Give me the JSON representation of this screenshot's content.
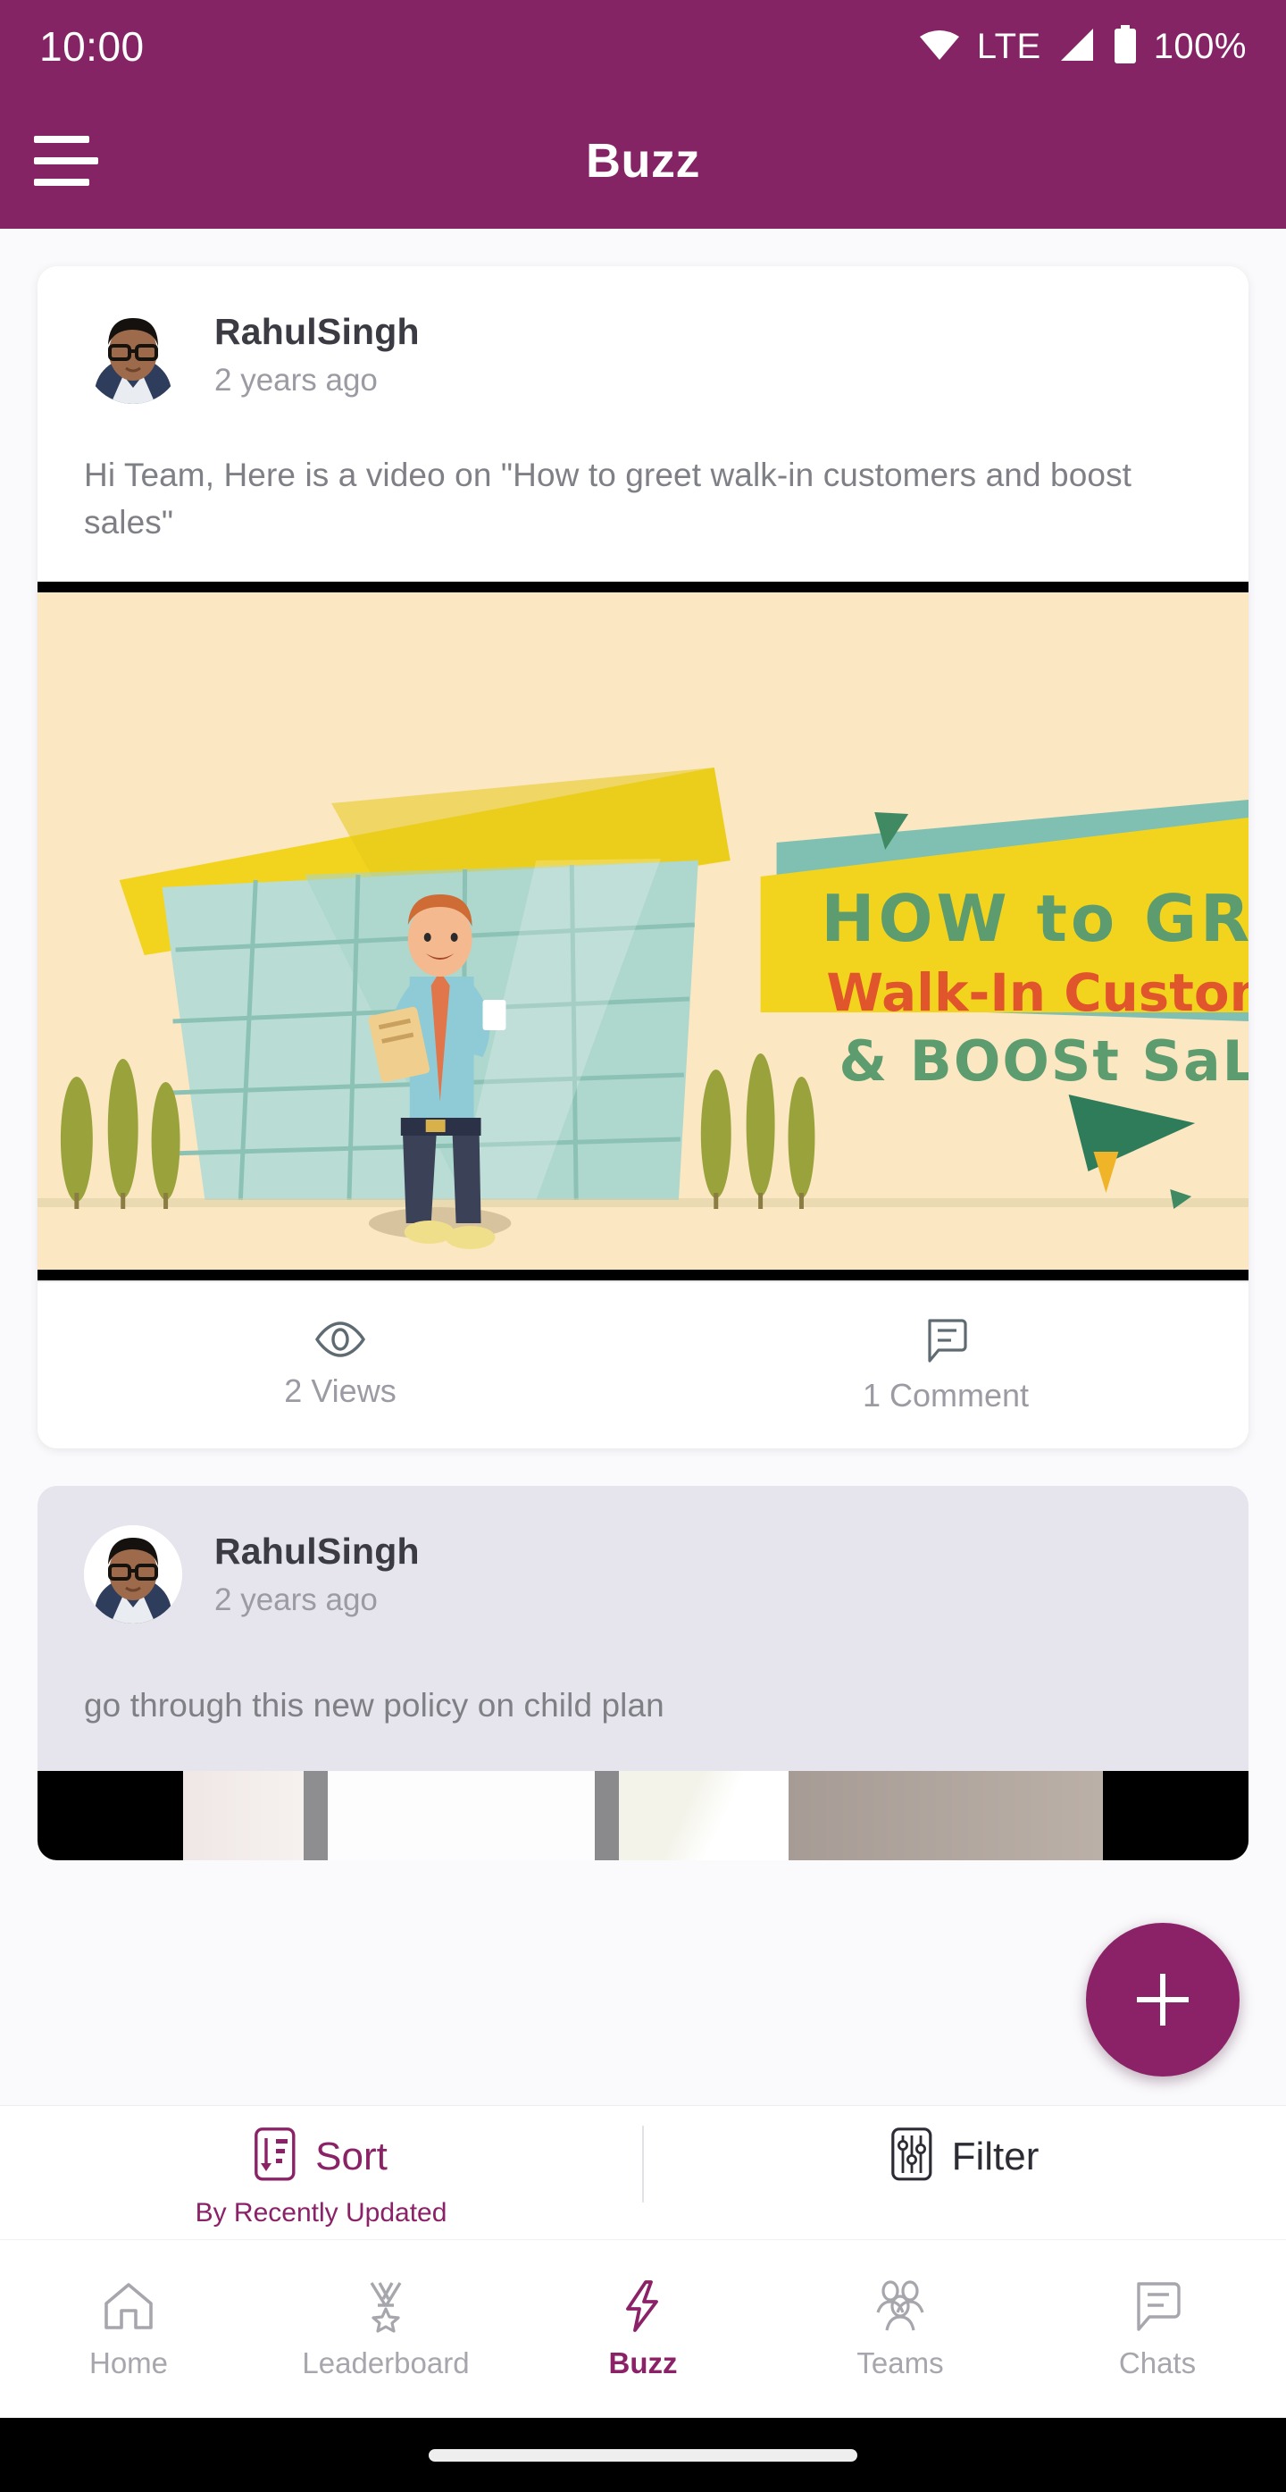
{
  "status_bar": {
    "time": "10:00",
    "network_label": "LTE",
    "battery_percent": "100%",
    "icons": [
      "wifi-icon",
      "signal-icon",
      "battery-icon"
    ]
  },
  "app_bar": {
    "title": "Buzz",
    "menu_icon": "hamburger-menu-icon",
    "background_color": "#842465"
  },
  "feed": {
    "posts": [
      {
        "author": "RahulSingh",
        "timestamp": "2 years ago",
        "text": "Hi Team, Here is a video on \"How to greet walk-in customers and boost sales\"",
        "media_type": "video",
        "media_title_line1": "HOW to GREEt",
        "media_title_line2": "Walk-In Customers",
        "media_title_line3": "& BOOSt SaLES",
        "views_label": "2 Views",
        "comments_label": "1 Comment",
        "views_icon": "eye-icon",
        "comments_icon": "comment-icon"
      },
      {
        "author": "RahulSingh",
        "timestamp": "2 years ago",
        "text": "go through this  new policy on child plan",
        "media_type": "image"
      }
    ]
  },
  "fab": {
    "icon": "plus-icon",
    "color": "#8b2268"
  },
  "sort_filter": {
    "sort_label": "Sort",
    "sort_sublabel": "By Recently Updated",
    "sort_icon": "sort-icon",
    "filter_label": "Filter",
    "filter_icon": "filter-sliders-icon"
  },
  "bottom_nav": {
    "items": [
      {
        "label": "Home",
        "icon": "home-icon",
        "active": false
      },
      {
        "label": "Leaderboard",
        "icon": "medal-icon",
        "active": false
      },
      {
        "label": "Buzz",
        "icon": "lightning-icon",
        "active": true
      },
      {
        "label": "Teams",
        "icon": "people-icon",
        "active": false
      },
      {
        "label": "Chats",
        "icon": "chat-bubble-icon",
        "active": false
      }
    ],
    "active_color": "#8b2268",
    "inactive_color": "#a6a6ad"
  }
}
